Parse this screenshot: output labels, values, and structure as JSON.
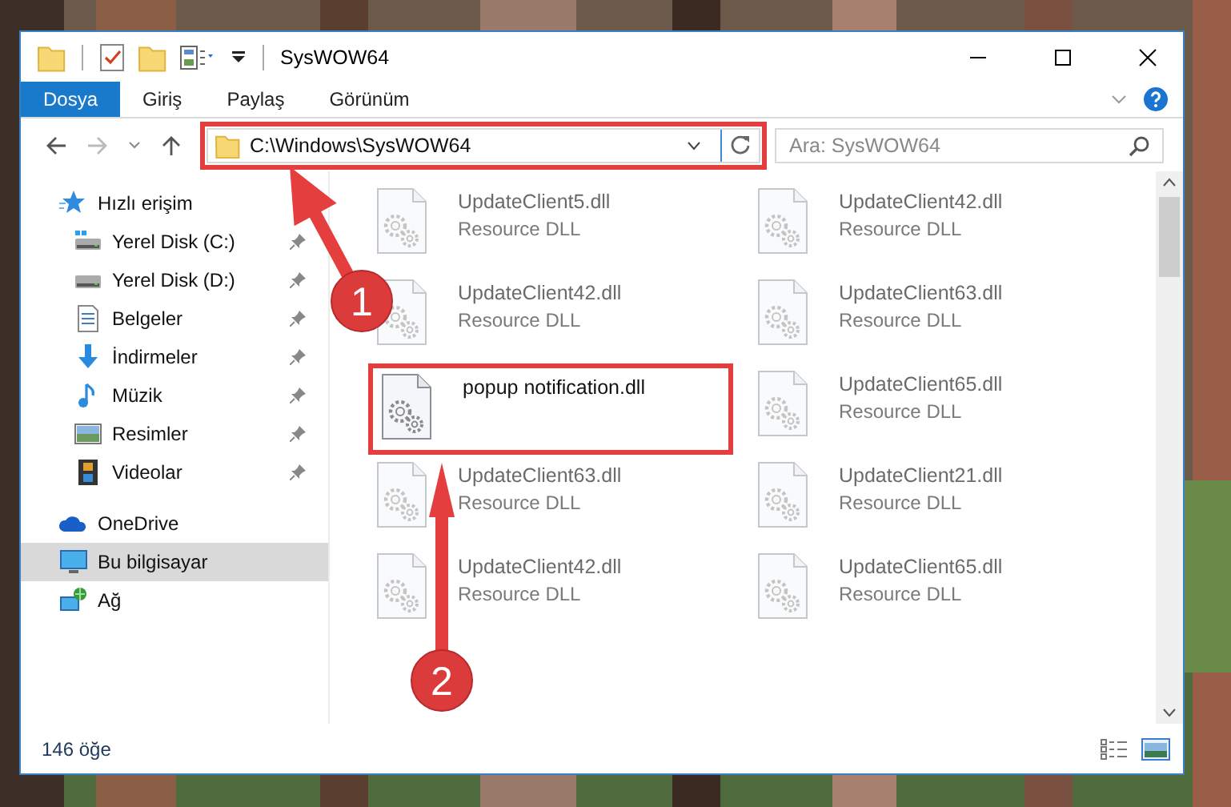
{
  "window": {
    "title": "SysWOW64"
  },
  "ribbon_tabs": [
    {
      "label": "Dosya",
      "selected": true
    },
    {
      "label": "Giriş",
      "selected": false
    },
    {
      "label": "Paylaş",
      "selected": false
    },
    {
      "label": "Görünüm",
      "selected": false
    }
  ],
  "address_bar": {
    "path": "C:\\Windows\\SysWOW64",
    "highlighted": true
  },
  "search": {
    "placeholder": "Ara: SysWOW64"
  },
  "navigation_pane": [
    {
      "label": "Hızlı erişim",
      "kind": "quick",
      "selected": false,
      "children": [
        {
          "label": "Yerel Disk (C:)",
          "kind": "system-drive",
          "selected": false,
          "pinned": true
        },
        {
          "label": "Yerel Disk (D:)",
          "kind": "drive",
          "selected": false,
          "pinned": true
        },
        {
          "label": "Belgeler",
          "kind": "documents",
          "selected": false,
          "pinned": true
        },
        {
          "label": "İndirmeler",
          "kind": "downloads",
          "selected": false,
          "pinned": true
        },
        {
          "label": "Müzik",
          "kind": "music",
          "selected": false,
          "pinned": true
        },
        {
          "label": "Resimler",
          "kind": "pictures",
          "selected": false,
          "pinned": true
        },
        {
          "label": "Videolar",
          "kind": "videos",
          "selected": false,
          "pinned": true
        }
      ]
    },
    {
      "label": "OneDrive",
      "kind": "cloud",
      "selected": false
    },
    {
      "label": "Bu bilgisayar",
      "kind": "computer",
      "selected": true
    },
    {
      "label": "Ağ",
      "kind": "network",
      "selected": false
    }
  ],
  "files": [
    {
      "name": "UpdateClient5.dll",
      "type": "Resource DLL",
      "dimmed": true,
      "highlighted": false
    },
    {
      "name": "UpdateClient42.dll",
      "type": "Resource DLL",
      "dimmed": true,
      "highlighted": false
    },
    {
      "name": "UpdateClient42.dll",
      "type": "Resource DLL",
      "dimmed": true,
      "highlighted": false
    },
    {
      "name": "UpdateClient63.dll",
      "type": "Resource DLL",
      "dimmed": true,
      "highlighted": false
    },
    {
      "name": "popup notification.dll",
      "dimmed": false,
      "highlighted": true
    },
    {
      "name": "UpdateClient65.dll",
      "type": "Resource DLL",
      "dimmed": true,
      "highlighted": false
    },
    {
      "name": "UpdateClient63.dll",
      "type": "Resource DLL",
      "dimmed": true,
      "highlighted": false
    },
    {
      "name": "UpdateClient21.dll",
      "type": "Resource DLL",
      "dimmed": true,
      "highlighted": false
    },
    {
      "name": "UpdateClient42.dll",
      "type": "Resource DLL",
      "dimmed": true,
      "highlighted": false
    },
    {
      "name": "UpdateClient65.dll",
      "type": "Resource DLL",
      "dimmed": true,
      "highlighted": false
    }
  ],
  "status_bar": {
    "item_count": "146 öğe"
  },
  "callouts": [
    {
      "label": "1"
    },
    {
      "label": "2"
    }
  ]
}
